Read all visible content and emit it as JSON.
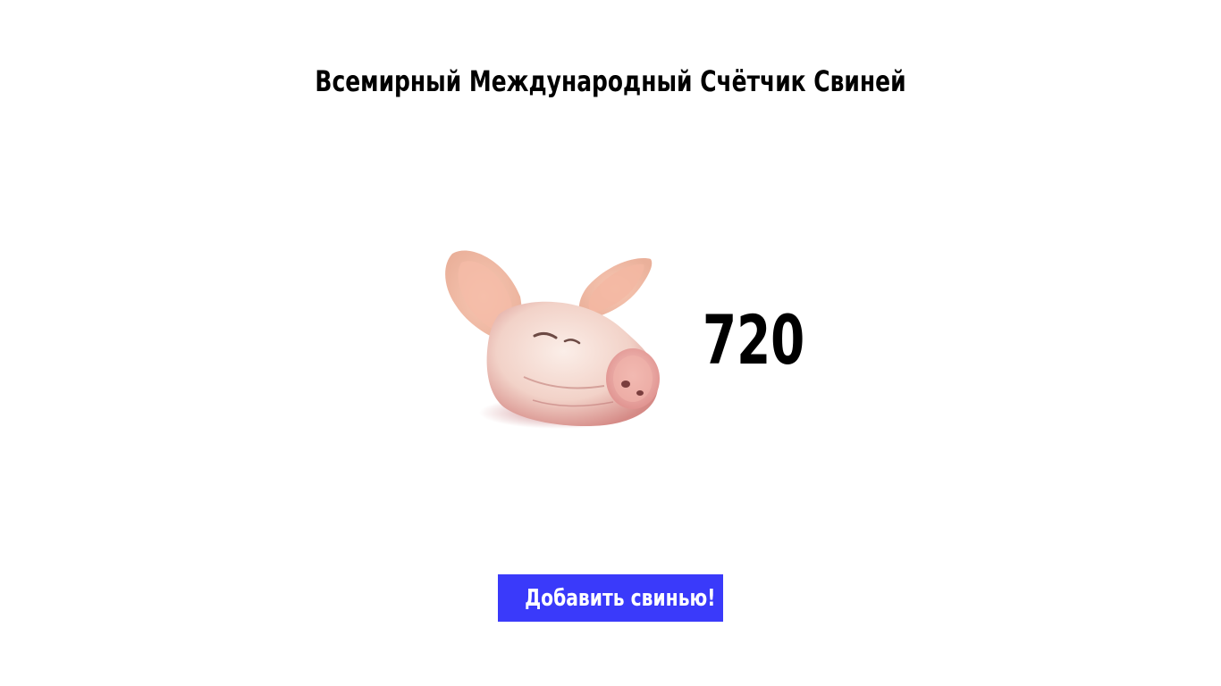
{
  "page": {
    "title": "Всемирный Международный Счётчик Свиней"
  },
  "counter": {
    "value": "720",
    "icon": "pig-head-icon"
  },
  "actions": {
    "add_label": "Добавить свинью!",
    "button_color": "#3a3afa"
  }
}
